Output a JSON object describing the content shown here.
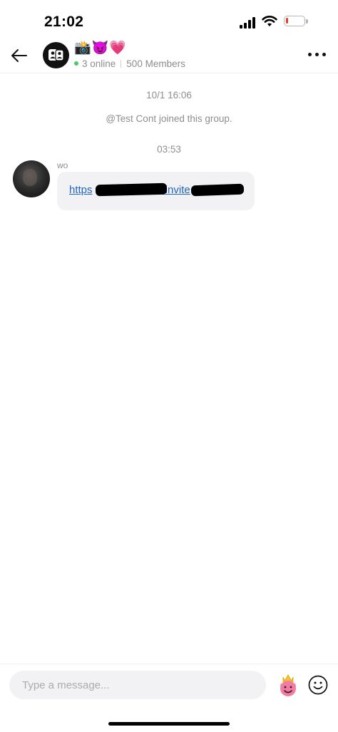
{
  "status_bar": {
    "time": "21:02",
    "battery_level": 0.15,
    "battery_color": "#e63a2e"
  },
  "header": {
    "group_name": "📸😈💗",
    "online_count": "3 online",
    "members": "500 Members",
    "online_color": "#4cc76b",
    "icons": {
      "back": "arrow-left-icon",
      "more": "more-horizontal-icon",
      "avatar": "group-people-icon"
    }
  },
  "chat": {
    "system_messages": [
      {
        "text": "10/1 16:06"
      },
      {
        "text": "@Test Cont joined this group."
      },
      {
        "text": "03:53"
      }
    ],
    "messages": [
      {
        "sender": "wo",
        "link_parts": [
          "https",
          "/invite"
        ],
        "link_color": "#1f66c2"
      }
    ]
  },
  "input": {
    "placeholder": "Type a message...",
    "sticker_icon": "crown-devil-sticker-icon",
    "emoji_icon": "smiley-face-icon"
  }
}
